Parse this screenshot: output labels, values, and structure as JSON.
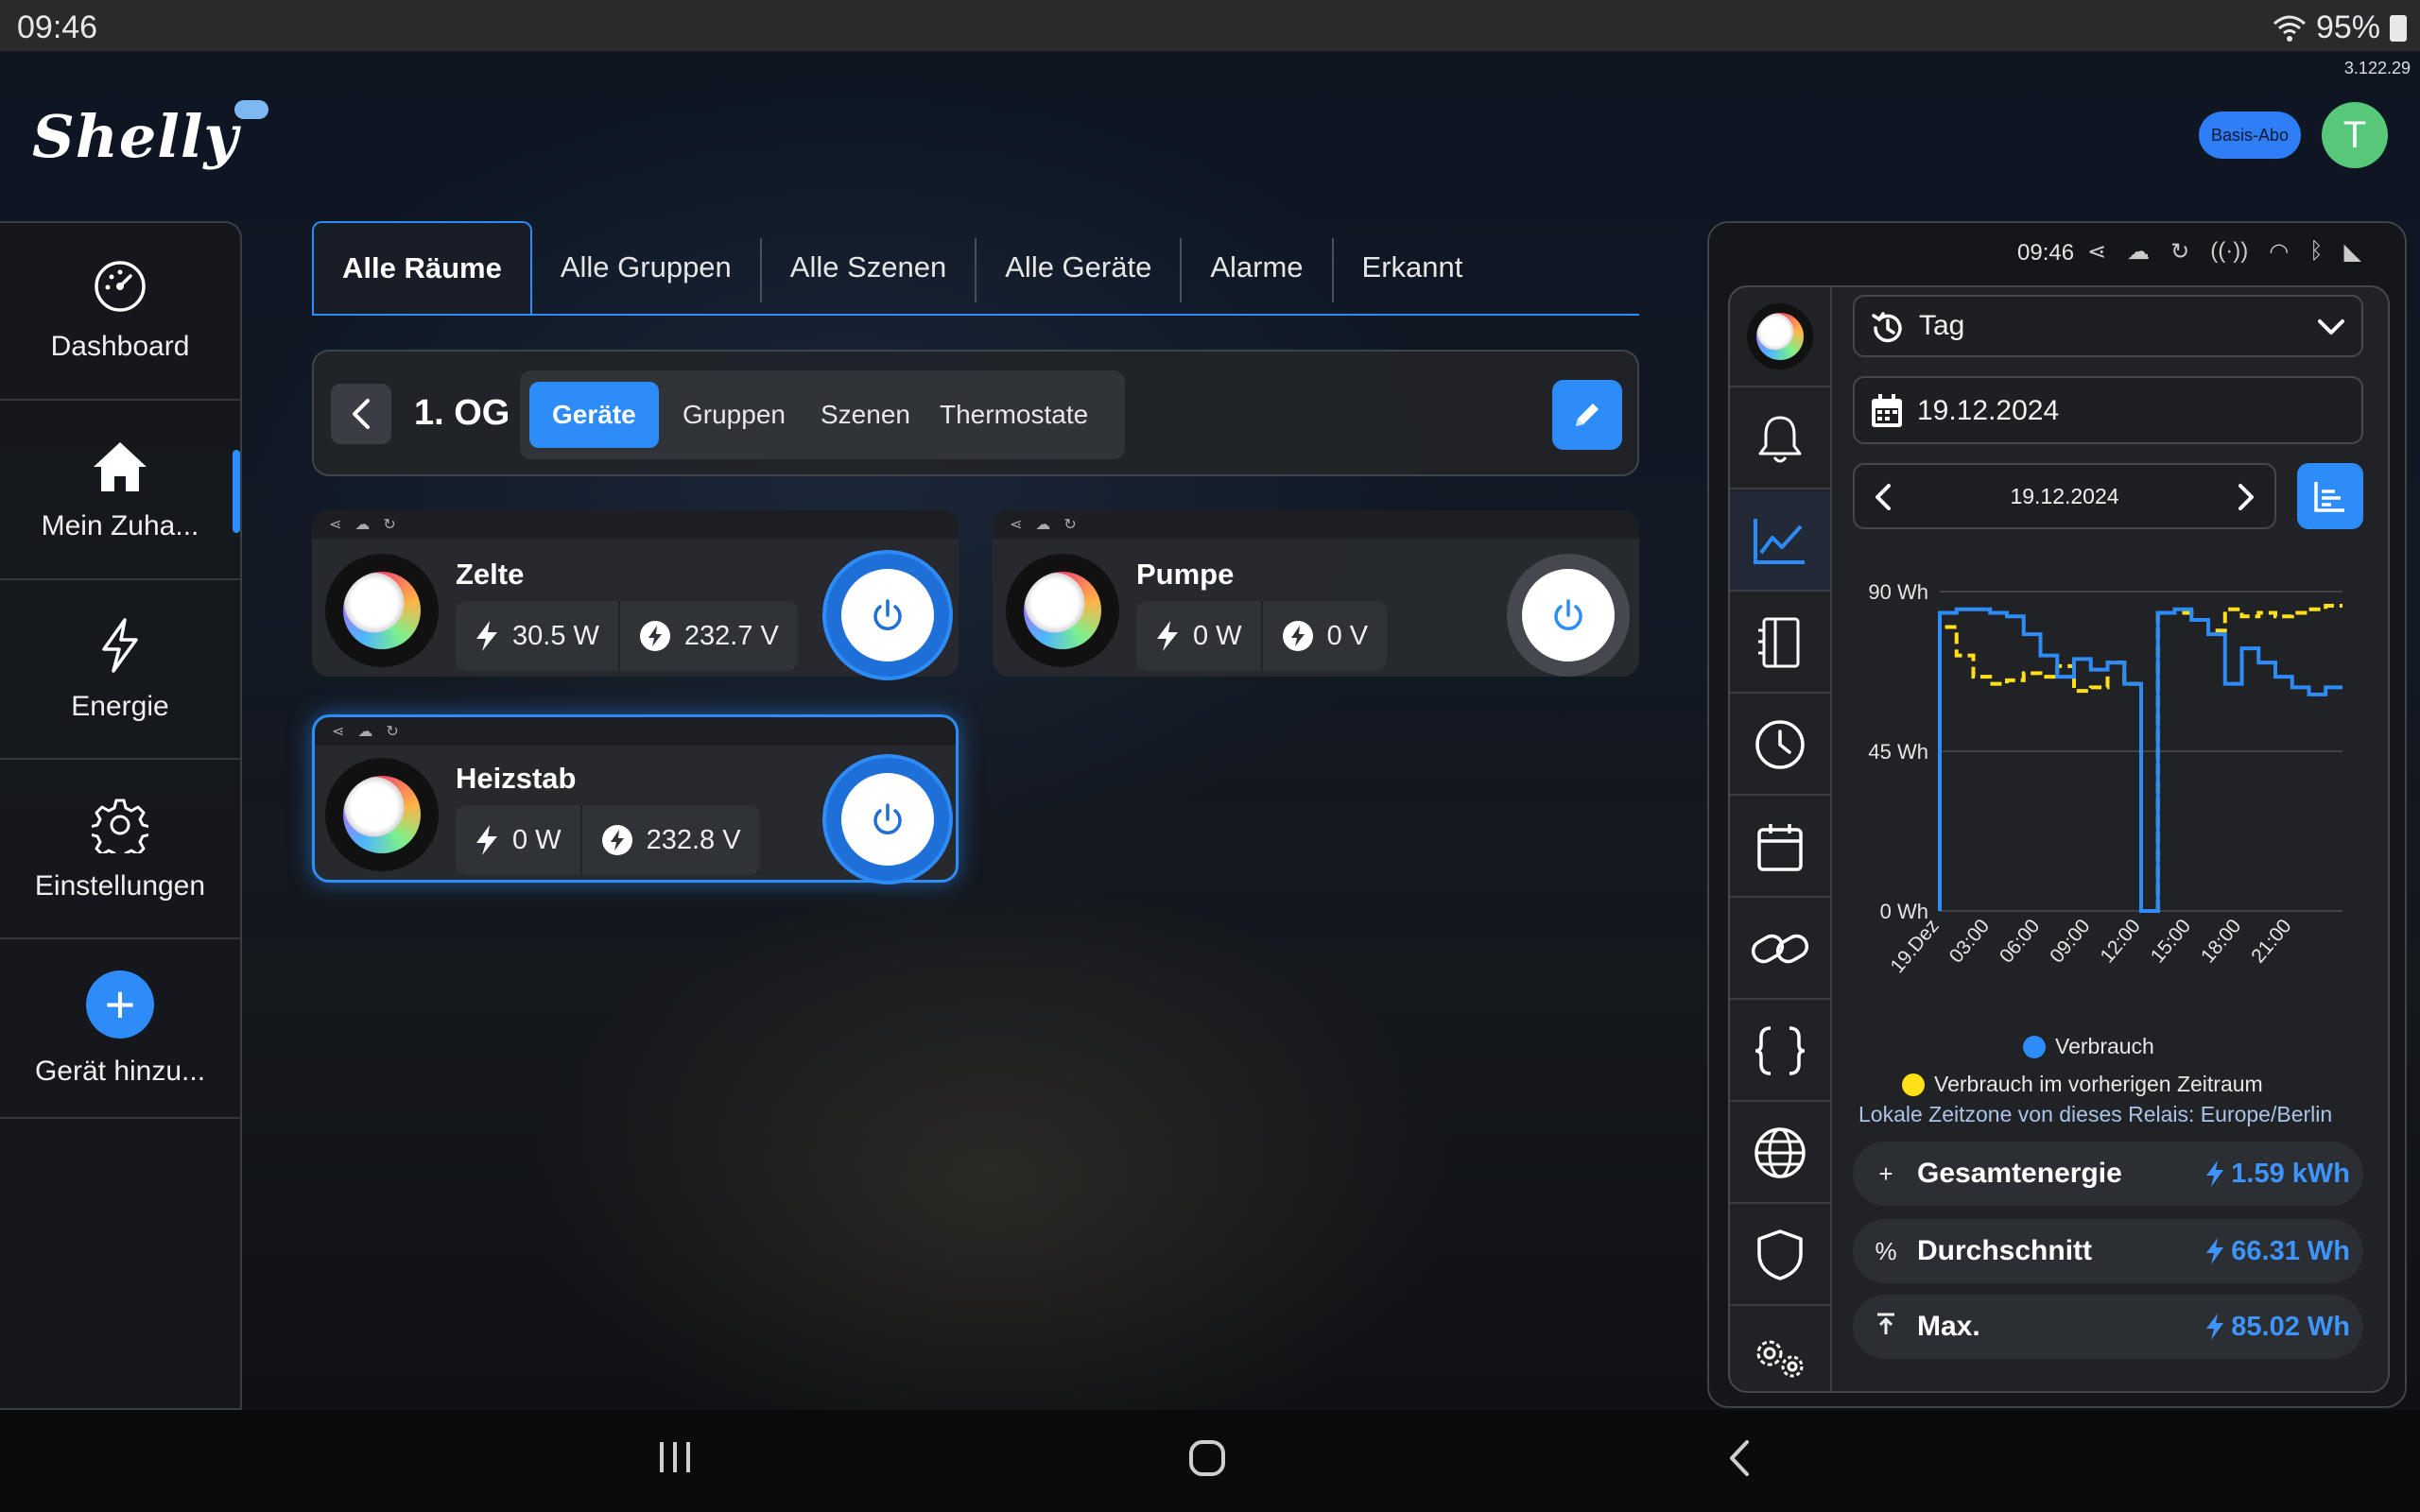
{
  "status_bar": {
    "time": "09:46",
    "battery": "95%"
  },
  "version": "3.122.29",
  "header": {
    "logo": "Shelly",
    "plan_badge": "Basis-Abo",
    "avatar_initial": "T"
  },
  "sidebar": {
    "items": [
      {
        "label": "Dashboard",
        "icon": "gauge-icon"
      },
      {
        "label": "Mein Zuha...",
        "icon": "home-icon",
        "active": true
      },
      {
        "label": "Energie",
        "icon": "lightning-icon"
      },
      {
        "label": "Einstellungen",
        "icon": "gear-icon"
      },
      {
        "label": "Gerät hinzu...",
        "icon": "plus-icon"
      }
    ]
  },
  "tabs": [
    "Alle Räume",
    "Alle Gruppen",
    "Alle Szenen",
    "Alle Geräte",
    "Alarme",
    "Erkannt"
  ],
  "room": {
    "title": "1. OG",
    "sub_tabs": [
      "Geräte",
      "Gruppen",
      "Szenen",
      "Thermostate"
    ]
  },
  "devices": [
    {
      "name": "Zelte",
      "power": "30.5 W",
      "voltage": "232.7 V",
      "on": true
    },
    {
      "name": "Pumpe",
      "power": "0 W",
      "voltage": "0 V",
      "on": false
    },
    {
      "name": "Heizstab",
      "power": "0 W",
      "voltage": "232.8 V",
      "on": true
    }
  ],
  "panel": {
    "time": "09:46",
    "period": "Tag",
    "date_field": "19.12.2024",
    "date_nav": "19.12.2024",
    "timezone_note": "Lokale Zeitzone von dieses Relais: Europe/Berlin",
    "stats": [
      {
        "icon": "+",
        "label": "Gesamtenergie",
        "value": "1.59 kWh"
      },
      {
        "icon": "%",
        "label": "Durchschnitt",
        "value": "66.31 Wh"
      },
      {
        "icon": "max-icon",
        "label": "Max.",
        "value": "85.02 Wh"
      }
    ]
  },
  "chart_data": {
    "type": "line",
    "title": "",
    "xlabel": "",
    "ylabel": "",
    "ylim": [
      0,
      90
    ],
    "y_ticks": [
      "90 Wh",
      "45 Wh",
      "0 Wh"
    ],
    "y_tick_values": [
      90,
      45,
      0
    ],
    "x_ticks": [
      "19.Dez",
      "03:00",
      "06:00",
      "09:00",
      "12:00",
      "15:00",
      "18:00",
      "21:00"
    ],
    "x_tick_hours": [
      0,
      3,
      6,
      9,
      12,
      15,
      18,
      21
    ],
    "grid": true,
    "legend_position": "bottom",
    "series": [
      {
        "name": "Verbrauch",
        "color": "#2d8cf7",
        "step": true,
        "x": [
          0,
          1,
          2,
          3,
          4,
          5,
          6,
          7,
          8,
          9,
          10,
          11,
          12,
          13,
          14,
          15,
          16,
          17,
          18,
          19,
          20,
          21,
          22,
          23
        ],
        "y": [
          84,
          85,
          85,
          84,
          83,
          78,
          72,
          66,
          71,
          68,
          70,
          64,
          0,
          84,
          85,
          82,
          78,
          64,
          74,
          70,
          66,
          63,
          61,
          63
        ]
      },
      {
        "name": "Verbrauch im vorherigen Zeitraum",
        "color": "#ffe019",
        "step": true,
        "dashed": true,
        "x": [
          0,
          1,
          2,
          3,
          4,
          5,
          6,
          7,
          8,
          9,
          10,
          11,
          12,
          13,
          14,
          15,
          16,
          17,
          18,
          19,
          20,
          21,
          22,
          23
        ],
        "y": [
          80,
          72,
          66,
          64,
          65,
          67,
          66,
          69,
          62,
          63,
          70,
          64,
          0,
          84,
          84,
          82,
          79,
          85,
          83,
          84,
          83,
          84,
          85,
          86
        ]
      }
    ]
  }
}
